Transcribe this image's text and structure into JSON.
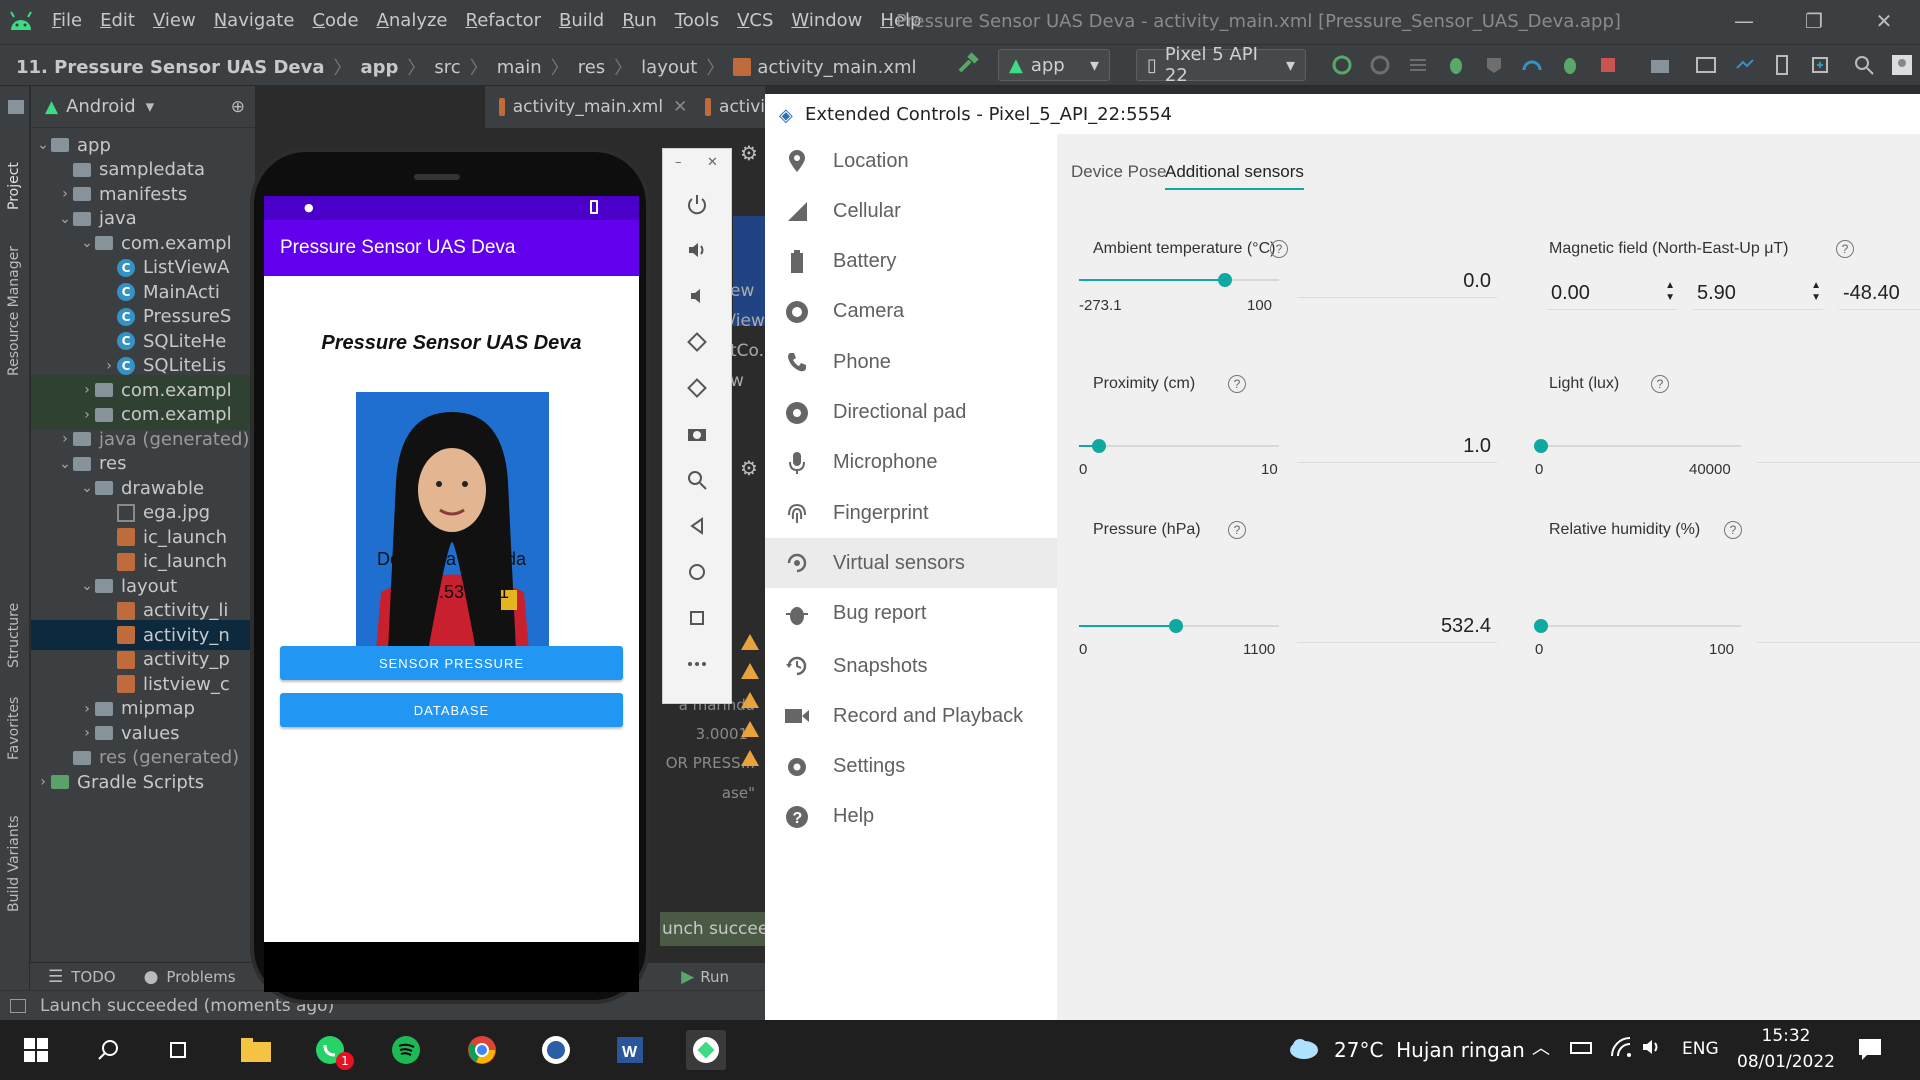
{
  "window": {
    "menu": [
      "File",
      "Edit",
      "View",
      "Navigate",
      "Code",
      "Analyze",
      "Refactor",
      "Build",
      "Run",
      "Tools",
      "VCS",
      "Window",
      "Help"
    ],
    "title": "Pressure Sensor UAS Deva - activity_main.xml [Pressure_Sensor_UAS_Deva.app]"
  },
  "breadcrumb": [
    "11. Pressure Sensor UAS Deva",
    "app",
    "src",
    "main",
    "res",
    "layout",
    "activity_main.xml"
  ],
  "toolbar": {
    "run_config": "app",
    "device": "Pixel 5 API 22"
  },
  "side_tabs": {
    "project": "Project",
    "resource_manager": "Resource Manager",
    "structure": "Structure",
    "favorites": "Favorites",
    "build_variants": "Build Variants"
  },
  "project_panel": {
    "view": "Android",
    "tree": [
      {
        "label": "app",
        "depth": 0,
        "arrow": "v",
        "icon": "folder"
      },
      {
        "label": "sampledata",
        "depth": 1,
        "arrow": "",
        "icon": "folder"
      },
      {
        "label": "manifests",
        "depth": 1,
        "arrow": ">",
        "icon": "folder"
      },
      {
        "label": "java",
        "depth": 1,
        "arrow": "v",
        "icon": "folder"
      },
      {
        "label": "com.exampl",
        "depth": 2,
        "arrow": "v",
        "icon": "folder"
      },
      {
        "label": "ListViewA",
        "depth": 3,
        "arrow": "",
        "icon": "class"
      },
      {
        "label": "MainActi",
        "depth": 3,
        "arrow": "",
        "icon": "class"
      },
      {
        "label": "PressureS",
        "depth": 3,
        "arrow": "",
        "icon": "class"
      },
      {
        "label": "SQLiteHe",
        "depth": 3,
        "arrow": "",
        "icon": "class"
      },
      {
        "label": "SQLiteLis",
        "depth": 3,
        "arrow": ">",
        "icon": "class"
      },
      {
        "label": "com.exampl",
        "depth": 2,
        "arrow": ">",
        "icon": "folder"
      },
      {
        "label": "com.exampl",
        "depth": 2,
        "arrow": ">",
        "icon": "folder"
      },
      {
        "label": "java (generated)",
        "depth": 1,
        "arrow": ">",
        "icon": "folder"
      },
      {
        "label": "res",
        "depth": 1,
        "arrow": "v",
        "icon": "folder"
      },
      {
        "label": "drawable",
        "depth": 2,
        "arrow": "v",
        "icon": "folder"
      },
      {
        "label": "ega.jpg",
        "depth": 3,
        "arrow": "",
        "icon": "jpg"
      },
      {
        "label": "ic_launch",
        "depth": 3,
        "arrow": "",
        "icon": "xml"
      },
      {
        "label": "ic_launch",
        "depth": 3,
        "arrow": "",
        "icon": "xml"
      },
      {
        "label": "layout",
        "depth": 2,
        "arrow": "v",
        "icon": "folder"
      },
      {
        "label": "activity_li",
        "depth": 3,
        "arrow": "",
        "icon": "xml"
      },
      {
        "label": "activity_n",
        "depth": 3,
        "arrow": "",
        "icon": "xml"
      },
      {
        "label": "activity_p",
        "depth": 3,
        "arrow": "",
        "icon": "xml"
      },
      {
        "label": "listview_c",
        "depth": 3,
        "arrow": "",
        "icon": "xml"
      },
      {
        "label": "mipmap",
        "depth": 2,
        "arrow": ">",
        "icon": "folder"
      },
      {
        "label": "values",
        "depth": 2,
        "arrow": ">",
        "icon": "folder"
      },
      {
        "label": "res (generated)",
        "depth": 1,
        "arrow": "",
        "icon": "folder"
      },
      {
        "label": "Gradle Scripts",
        "depth": 0,
        "arrow": ">",
        "icon": "gradle"
      }
    ]
  },
  "editor": {
    "tabs": [
      "activity_main.xml",
      "activi"
    ],
    "fragments": [
      "ew",
      "/iew",
      "tCo.",
      "w",
      "a marinda",
      "3.0001\"",
      "OR PRESS...",
      "ase\""
    ],
    "launch_toast": "unch succeede",
    "run_tab": "Run"
  },
  "bottom_tools": {
    "todo": "TODO",
    "problems": "Problems"
  },
  "status": "Launch succeeded (moments ago)",
  "phone": {
    "app_title": "Pressure Sensor UAS Deva",
    "heading": "Pressure Sensor UAS Deva",
    "name": "Deva Ega Marinda",
    "nim": "19.01.53.0001",
    "btn_sensor": "SENSOR PRESSURE",
    "btn_database": "DATABASE"
  },
  "extended": {
    "title": "Extended Controls - Pixel_5_API_22:5554",
    "nav": [
      "Location",
      "Cellular",
      "Battery",
      "Camera",
      "Phone",
      "Directional pad",
      "Microphone",
      "Fingerprint",
      "Virtual sensors",
      "Bug report",
      "Snapshots",
      "Record and Playback",
      "Settings",
      "Help"
    ],
    "active_nav": "Virtual sensors",
    "tabs": [
      "Device Pose",
      "Additional sensors"
    ],
    "active_tab": "Additional sensors",
    "sensors": {
      "ambient": {
        "label": "Ambient temperature (°C)",
        "min": "-273.1",
        "max": "100",
        "value": "0.0",
        "fraction": 0.73
      },
      "magnetic": {
        "label": "Magnetic field (North-East-Up μT)",
        "x": "0.00",
        "y": "5.90",
        "z": "-48.40"
      },
      "proximity": {
        "label": "Proximity (cm)",
        "min": "0",
        "max": "10",
        "value": "1.0",
        "fraction": 0.1
      },
      "light": {
        "label": "Light (lux)",
        "min": "0",
        "max": "40000",
        "fraction": 0
      },
      "pressure": {
        "label": "Pressure (hPa)",
        "min": "0",
        "max": "1100",
        "value": "532.4",
        "fraction": 0.484
      },
      "humidity": {
        "label": "Relative humidity (%)",
        "min": "0",
        "max": "100",
        "fraction": 0
      }
    }
  },
  "taskbar": {
    "weather": "27°C  Hujan ringan",
    "lang": "ENG",
    "time": "15:32",
    "date": "08/01/2022",
    "whatsapp_badge": "1"
  },
  "colors": {
    "accent": "#10a9a0",
    "app_primary": "#6200ee",
    "button": "#2196f3"
  }
}
